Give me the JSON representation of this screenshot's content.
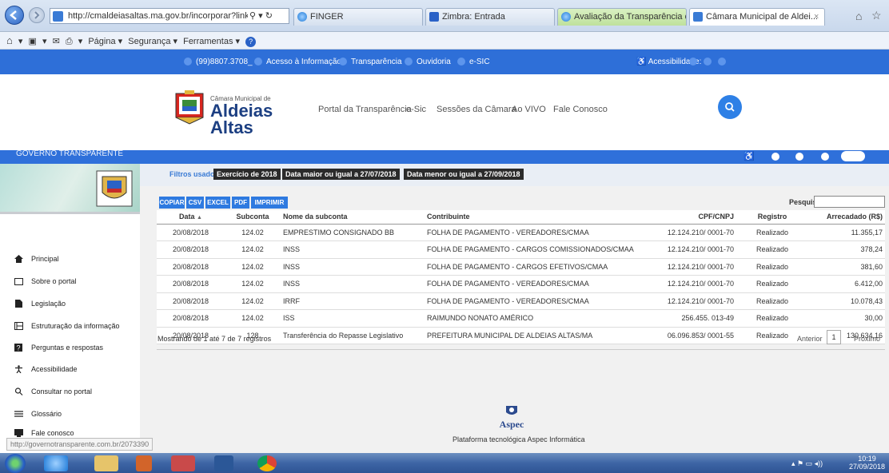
{
  "browser": {
    "url": "http://cmaldeiasaltas.ma.gov.br/incorporar?link=http",
    "tabs": [
      "FINGER",
      "Zimbra: Entrada",
      "Avaliação da Transparência do...",
      "Câmara Municipal de Aldei..."
    ],
    "tab_close": "×",
    "menu": [
      "Página ▾",
      "Segurança ▾",
      "Ferramentas ▾"
    ],
    "status_url": "http://governotransparente.com.br/2073390"
  },
  "topbar": {
    "phone": "(99)8807.3708_",
    "items": [
      "Acesso à Informação",
      "Transparência",
      "Ouvidoria",
      "e-SIC"
    ],
    "accessibility": "Acessibilidade:"
  },
  "header": {
    "logo_sub": "Câmara Municipal de",
    "logo_name_1": "Aldeias",
    "logo_name_2": "Altas",
    "nav": [
      "Portal da Transparência",
      "e-Sic",
      "Sessões da Câmara",
      "Ao VIVO",
      "Fale Conosco"
    ]
  },
  "gt": {
    "title": "GOVERNO TRANSPARENTE"
  },
  "sidebar": {
    "items": [
      {
        "label": "Principal",
        "icon": "home-icon"
      },
      {
        "label": "Sobre o portal",
        "icon": "folder-icon"
      },
      {
        "label": "Legislação",
        "icon": "document-icon"
      },
      {
        "label": "Estruturação da informação",
        "icon": "structure-icon"
      },
      {
        "label": "Perguntas e respostas",
        "icon": "question-icon"
      },
      {
        "label": "Acessibilidade",
        "icon": "accessibility-icon"
      },
      {
        "label": "Consultar no portal",
        "icon": "search-icon"
      },
      {
        "label": "Glossário",
        "icon": "list-icon"
      },
      {
        "label": "Fale conosco",
        "icon": "contact-icon"
      }
    ]
  },
  "filters": {
    "label": "Filtros usados:",
    "chips": [
      "Exercício de 2018",
      "Data maior ou igual a 27/07/2018",
      "Data menor ou igual a 27/09/2018"
    ]
  },
  "toolbar": {
    "buttons": [
      "COPIAR",
      "CSV",
      "EXCEL",
      "PDF",
      "IMPRIMIR"
    ],
    "search_label": "Pesquisar"
  },
  "table": {
    "columns": [
      "Data",
      "Subconta",
      "Nome da subconta",
      "Contribuinte",
      "CPF/CNPJ",
      "Registro",
      "Arrecadado (R$)"
    ],
    "rows": [
      [
        "20/08/2018",
        "124.02",
        "EMPRESTIMO CONSIGNADO BB",
        "FOLHA DE PAGAMENTO - VEREADORES/CMAA",
        "12.124.210/ 0001-70",
        "Realizado",
        "11.355,17"
      ],
      [
        "20/08/2018",
        "124.02",
        "INSS",
        "FOLHA DE PAGAMENTO - CARGOS COMISSIONADOS/CMAA",
        "12.124.210/ 0001-70",
        "Realizado",
        "378,24"
      ],
      [
        "20/08/2018",
        "124.02",
        "INSS",
        "FOLHA DE PAGAMENTO - CARGOS EFETIVOS/CMAA",
        "12.124.210/ 0001-70",
        "Realizado",
        "381,60"
      ],
      [
        "20/08/2018",
        "124.02",
        "INSS",
        "FOLHA DE PAGAMENTO - VEREADORES/CMAA",
        "12.124.210/ 0001-70",
        "Realizado",
        "6.412,00"
      ],
      [
        "20/08/2018",
        "124.02",
        "IRRF",
        "FOLHA DE PAGAMENTO - VEREADORES/CMAA",
        "12.124.210/ 0001-70",
        "Realizado",
        "10.078,43"
      ],
      [
        "20/08/2018",
        "124.02",
        "ISS",
        "RAIMUNDO NONATO AMÉRICO",
        "256.455. 013-49",
        "Realizado",
        "30,00"
      ],
      [
        "20/08/2018",
        "128",
        "Transferência do Repasse Legislativo",
        "PREFEITURA MUNICIPAL DE ALDEIAS ALTAS/MA",
        "06.096.853/ 0001-55",
        "Realizado",
        "130.634,16"
      ]
    ],
    "info": "Mostrando de 1 até 7 de 7 registros",
    "prev": "Anterior",
    "page": "1",
    "next": "Próximo"
  },
  "footer": {
    "brand": "Aspec",
    "text": "Plataforma tecnológica Aspec Informática"
  },
  "taskbar": {
    "time": "10:19",
    "date": "27/09/2018"
  },
  "colors": {
    "site_blue": "#2e6fd8",
    "button_blue": "#2e7ae0",
    "logo_navy": "#1c3f82"
  }
}
